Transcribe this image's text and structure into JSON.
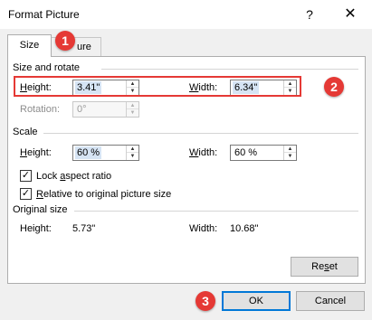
{
  "window": {
    "title": "Format Picture",
    "help_label": "?",
    "close_label": "✕"
  },
  "tabs": [
    {
      "label": "Size",
      "active": true
    },
    {
      "label": "ure",
      "active": false
    }
  ],
  "size_and_rotate": {
    "header": "Size and rotate",
    "height_label_prefix": "H",
    "height_label_rest": "eight:",
    "height_value": "3.41\"",
    "width_label_prefix": "W",
    "width_label_rest": "idth:",
    "width_value": "6.34\"",
    "rotation_label": "Rotation:",
    "rotation_value": "0°"
  },
  "scale": {
    "header": "Scale",
    "height_label_prefix": "H",
    "height_label_rest": "eight:",
    "height_value": "60 %",
    "width_label_prefix": "W",
    "width_label_rest": "idth:",
    "width_value": "60 %",
    "lock_aspect_prefix": "Lock ",
    "lock_aspect_u": "a",
    "lock_aspect_rest": "spect ratio",
    "lock_aspect_checked": true,
    "relative_prefix": "",
    "relative_u": "R",
    "relative_rest": "elative to original picture size",
    "relative_checked": true
  },
  "original_size": {
    "header": "Original size",
    "height_label": "Height:",
    "height_value": "5.73\"",
    "width_label": "Width:",
    "width_value": "10.68\""
  },
  "buttons": {
    "reset_prefix": "Re",
    "reset_u": "s",
    "reset_rest": "et",
    "ok": "OK",
    "cancel": "Cancel"
  },
  "annotations": {
    "badge1": "1",
    "badge2": "2",
    "badge3": "3",
    "color": "#e53935"
  },
  "colors": {
    "accent": "#0078d7",
    "annotation_red": "#e53935"
  }
}
